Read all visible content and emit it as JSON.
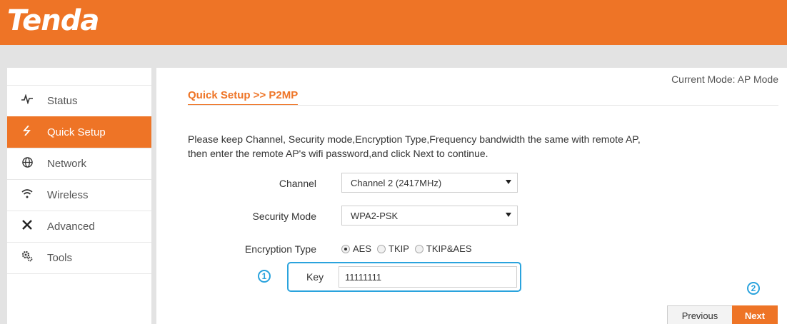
{
  "brand": {
    "logo_text": "Tenda",
    "accent_color": "#ee7426",
    "highlight_color": "#2aa3dd"
  },
  "header": {
    "mode_label": "Current Mode: AP Mode"
  },
  "sidebar": {
    "items": [
      {
        "label": "Status",
        "icon": "pulse-icon",
        "active": false
      },
      {
        "label": "Quick Setup",
        "icon": "lightning-icon",
        "active": true
      },
      {
        "label": "Network",
        "icon": "globe-icon",
        "active": false
      },
      {
        "label": "Wireless",
        "icon": "wifi-icon",
        "active": false
      },
      {
        "label": "Advanced",
        "icon": "tools-icon",
        "active": false
      },
      {
        "label": "Tools",
        "icon": "gears-icon",
        "active": false
      }
    ]
  },
  "main": {
    "title": "Quick Setup >>  P2MP",
    "description_line1": "Please keep Channel, Security mode,Encryption Type,Frequency bandwidth the same with remote AP,",
    "description_line2": "then enter the remote AP's wifi password,and click Next to continue.",
    "channel": {
      "label": "Channel",
      "value": "Channel 2 (2417MHz)"
    },
    "security_mode": {
      "label": "Security Mode",
      "value": "WPA2-PSK"
    },
    "encryption_type": {
      "label": "Encryption Type",
      "options": [
        "AES",
        "TKIP",
        "TKIP&AES"
      ],
      "selected": "AES"
    },
    "key": {
      "label": "Key",
      "value": "11111111"
    },
    "annotations": {
      "step1": "1",
      "step2": "2"
    },
    "buttons": {
      "previous": "Previous",
      "next": "Next"
    }
  }
}
